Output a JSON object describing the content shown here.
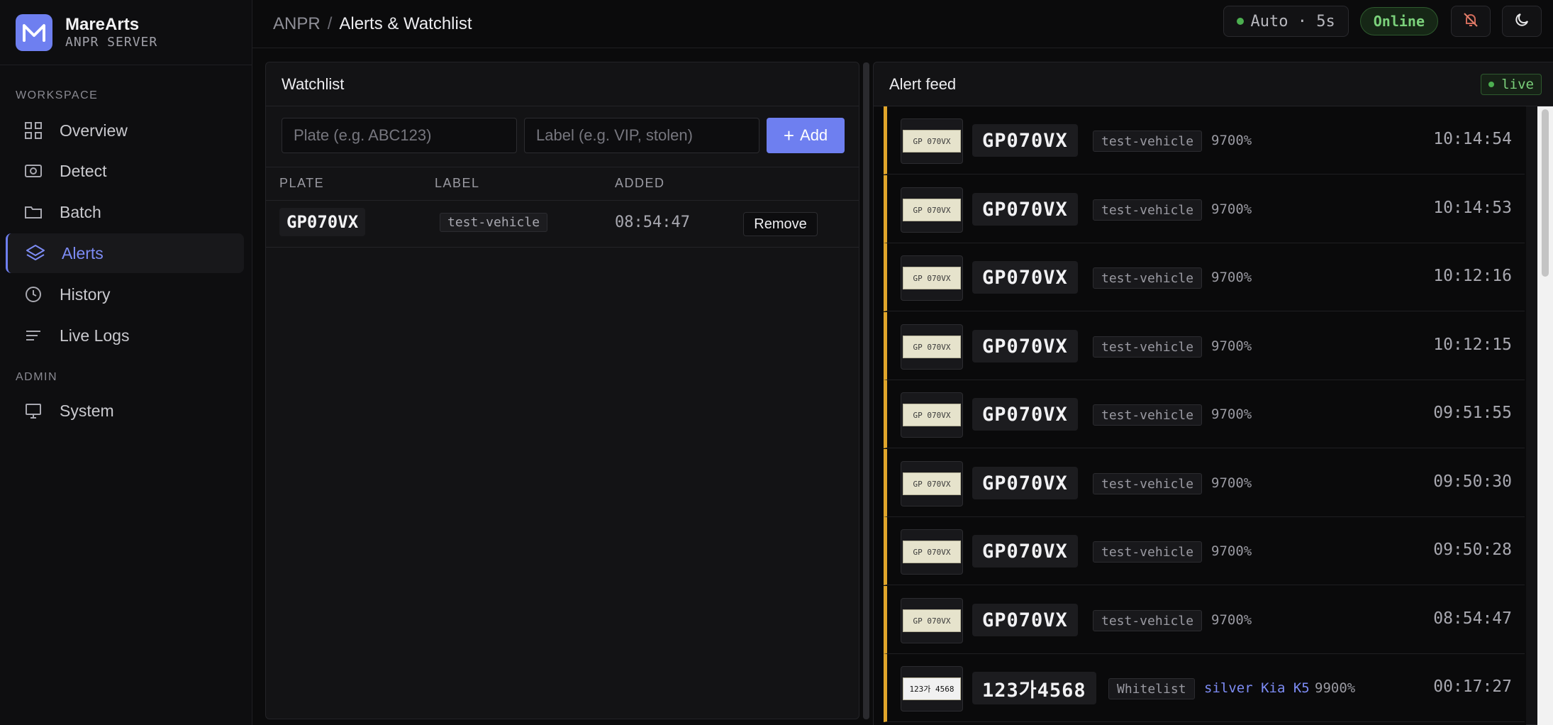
{
  "brand": {
    "name": "MareArts",
    "sub": "ANPR SERVER"
  },
  "sidebar": {
    "sections": [
      {
        "label": "WORKSPACE"
      },
      {
        "label": "ADMIN"
      }
    ],
    "items": [
      {
        "label": "Overview",
        "icon": "grid-icon"
      },
      {
        "label": "Detect",
        "icon": "camera-icon"
      },
      {
        "label": "Batch",
        "icon": "folder-icon"
      },
      {
        "label": "Alerts",
        "icon": "layers-icon",
        "active": true
      },
      {
        "label": "History",
        "icon": "clock-icon"
      },
      {
        "label": "Live Logs",
        "icon": "list-icon"
      },
      {
        "label": "System",
        "icon": "monitor-icon"
      }
    ]
  },
  "header": {
    "crumb_root": "ANPR",
    "crumb_sep": "/",
    "crumb_current": "Alerts & Watchlist",
    "auto_refresh": "Auto · 5s",
    "status": "Online"
  },
  "watchlist": {
    "title": "Watchlist",
    "plate_placeholder": "Plate (e.g. ABC123)",
    "label_placeholder": "Label (e.g. VIP, stolen)",
    "add_label": "Add",
    "columns": [
      "PLATE",
      "LABEL",
      "ADDED"
    ],
    "rows": [
      {
        "plate": "GP070VX",
        "label": "test-vehicle",
        "added": "08:54:47",
        "action": "Remove"
      }
    ]
  },
  "alerts": {
    "title": "Alert feed",
    "live_label": "live",
    "items": [
      {
        "plate": "GP070VX",
        "label": "test-vehicle",
        "extra": "",
        "pct": "9700%",
        "time": "10:14:54",
        "thumb": "GP 070VX"
      },
      {
        "plate": "GP070VX",
        "label": "test-vehicle",
        "extra": "",
        "pct": "9700%",
        "time": "10:14:53",
        "thumb": "GP 070VX"
      },
      {
        "plate": "GP070VX",
        "label": "test-vehicle",
        "extra": "",
        "pct": "9700%",
        "time": "10:12:16",
        "thumb": "GP 070VX"
      },
      {
        "plate": "GP070VX",
        "label": "test-vehicle",
        "extra": "",
        "pct": "9700%",
        "time": "10:12:15",
        "thumb": "GP 070VX"
      },
      {
        "plate": "GP070VX",
        "label": "test-vehicle",
        "extra": "",
        "pct": "9700%",
        "time": "09:51:55",
        "thumb": "GP 070VX"
      },
      {
        "plate": "GP070VX",
        "label": "test-vehicle",
        "extra": "",
        "pct": "9700%",
        "time": "09:50:30",
        "thumb": "GP 070VX"
      },
      {
        "plate": "GP070VX",
        "label": "test-vehicle",
        "extra": "",
        "pct": "9700%",
        "time": "09:50:28",
        "thumb": "GP 070VX"
      },
      {
        "plate": "GP070VX",
        "label": "test-vehicle",
        "extra": "",
        "pct": "9700%",
        "time": "08:54:47",
        "thumb": "GP 070VX"
      },
      {
        "plate": "123가4568",
        "label": "Whitelist",
        "extra": "silver Kia K5",
        "pct": "9900%",
        "time": "00:17:27",
        "thumb": "123가 4568"
      }
    ]
  },
  "colors": {
    "accent": "#6e7ff0",
    "alert_border": "#e0a52a",
    "online": "#7bd17b"
  }
}
